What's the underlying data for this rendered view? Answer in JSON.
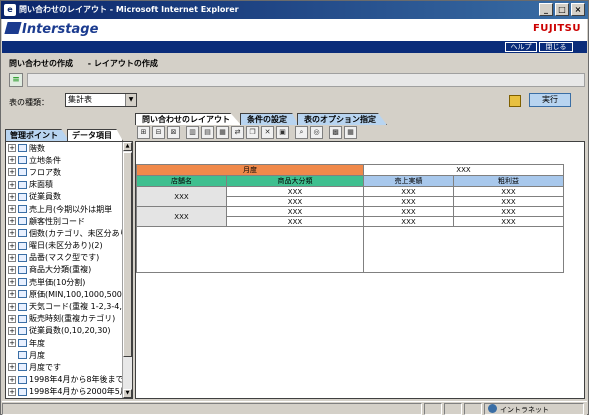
{
  "window": {
    "title": "問い合わせのレイアウト - Microsoft Internet Explorer"
  },
  "header": {
    "logo": "Interstage",
    "brand": "FUJITSU",
    "help_label": "ヘルプ",
    "close_label": "閉じる"
  },
  "page": {
    "title": "問い合わせの作成",
    "subtitle": "- レイアウトの作成"
  },
  "form": {
    "table_type_label": "表の種類：",
    "table_type_value": "集計表",
    "execute_label": "実行"
  },
  "tabs": [
    {
      "label": "問い合わせのレイアウト",
      "active": true
    },
    {
      "label": "条件の設定",
      "active": false
    },
    {
      "label": "表のオプション指定",
      "active": false
    }
  ],
  "left_tabs": [
    {
      "label": "管理ポイント",
      "active": false
    },
    {
      "label": "データ項目",
      "active": true
    }
  ],
  "tree": [
    {
      "label": "階数",
      "expandable": true
    },
    {
      "label": "立地条件",
      "expandable": true
    },
    {
      "label": "フロア数",
      "expandable": true
    },
    {
      "label": "床面積",
      "expandable": true
    },
    {
      "label": "従業員数",
      "expandable": true
    },
    {
      "label": "売上月(今期以外は期単",
      "expandable": true
    },
    {
      "label": "顧客性別コード",
      "expandable": true
    },
    {
      "label": "個数(カテゴリ、未区分あり)",
      "expandable": true
    },
    {
      "label": "曜日(未区分あり)(2)",
      "expandable": true
    },
    {
      "label": "品番(マスク型です)",
      "expandable": true
    },
    {
      "label": "商品大分類(重複)",
      "expandable": true
    },
    {
      "label": "売単価(10分割)",
      "expandable": true
    },
    {
      "label": "原価(MIN,100,1000,5000,",
      "expandable": true
    },
    {
      "label": "天気コード(重複 1-2,3-4,1",
      "expandable": true
    },
    {
      "label": "販売時刻(重複カテゴリ)",
      "expandable": true
    },
    {
      "label": "従業員数(0,10,20,30)",
      "expandable": true
    },
    {
      "label": "年度",
      "expandable": true
    },
    {
      "label": "月度",
      "expandable": false
    },
    {
      "label": "月度です",
      "expandable": true
    },
    {
      "label": "1998年4月から8年後まで",
      "expandable": true
    },
    {
      "label": "1998年4月から2000年5月",
      "expandable": true
    }
  ],
  "layout_grid": {
    "top_header_left": "月度",
    "top_header_right": "XXX",
    "col_store": "店舗名",
    "col_category": "商品大分類",
    "col_sales": "売上実績",
    "col_profit": "粗利益",
    "placeholder": "XXX"
  },
  "status": {
    "zone_label": "イントラネット"
  },
  "colors": {
    "title_bar": "#0a246a",
    "header_band": "#0a2c7a",
    "dimension_header": "#f0894a",
    "row_header": "#3fbf8f",
    "measure_header": "#a8c8ec",
    "brand_red": "#cc0000"
  }
}
